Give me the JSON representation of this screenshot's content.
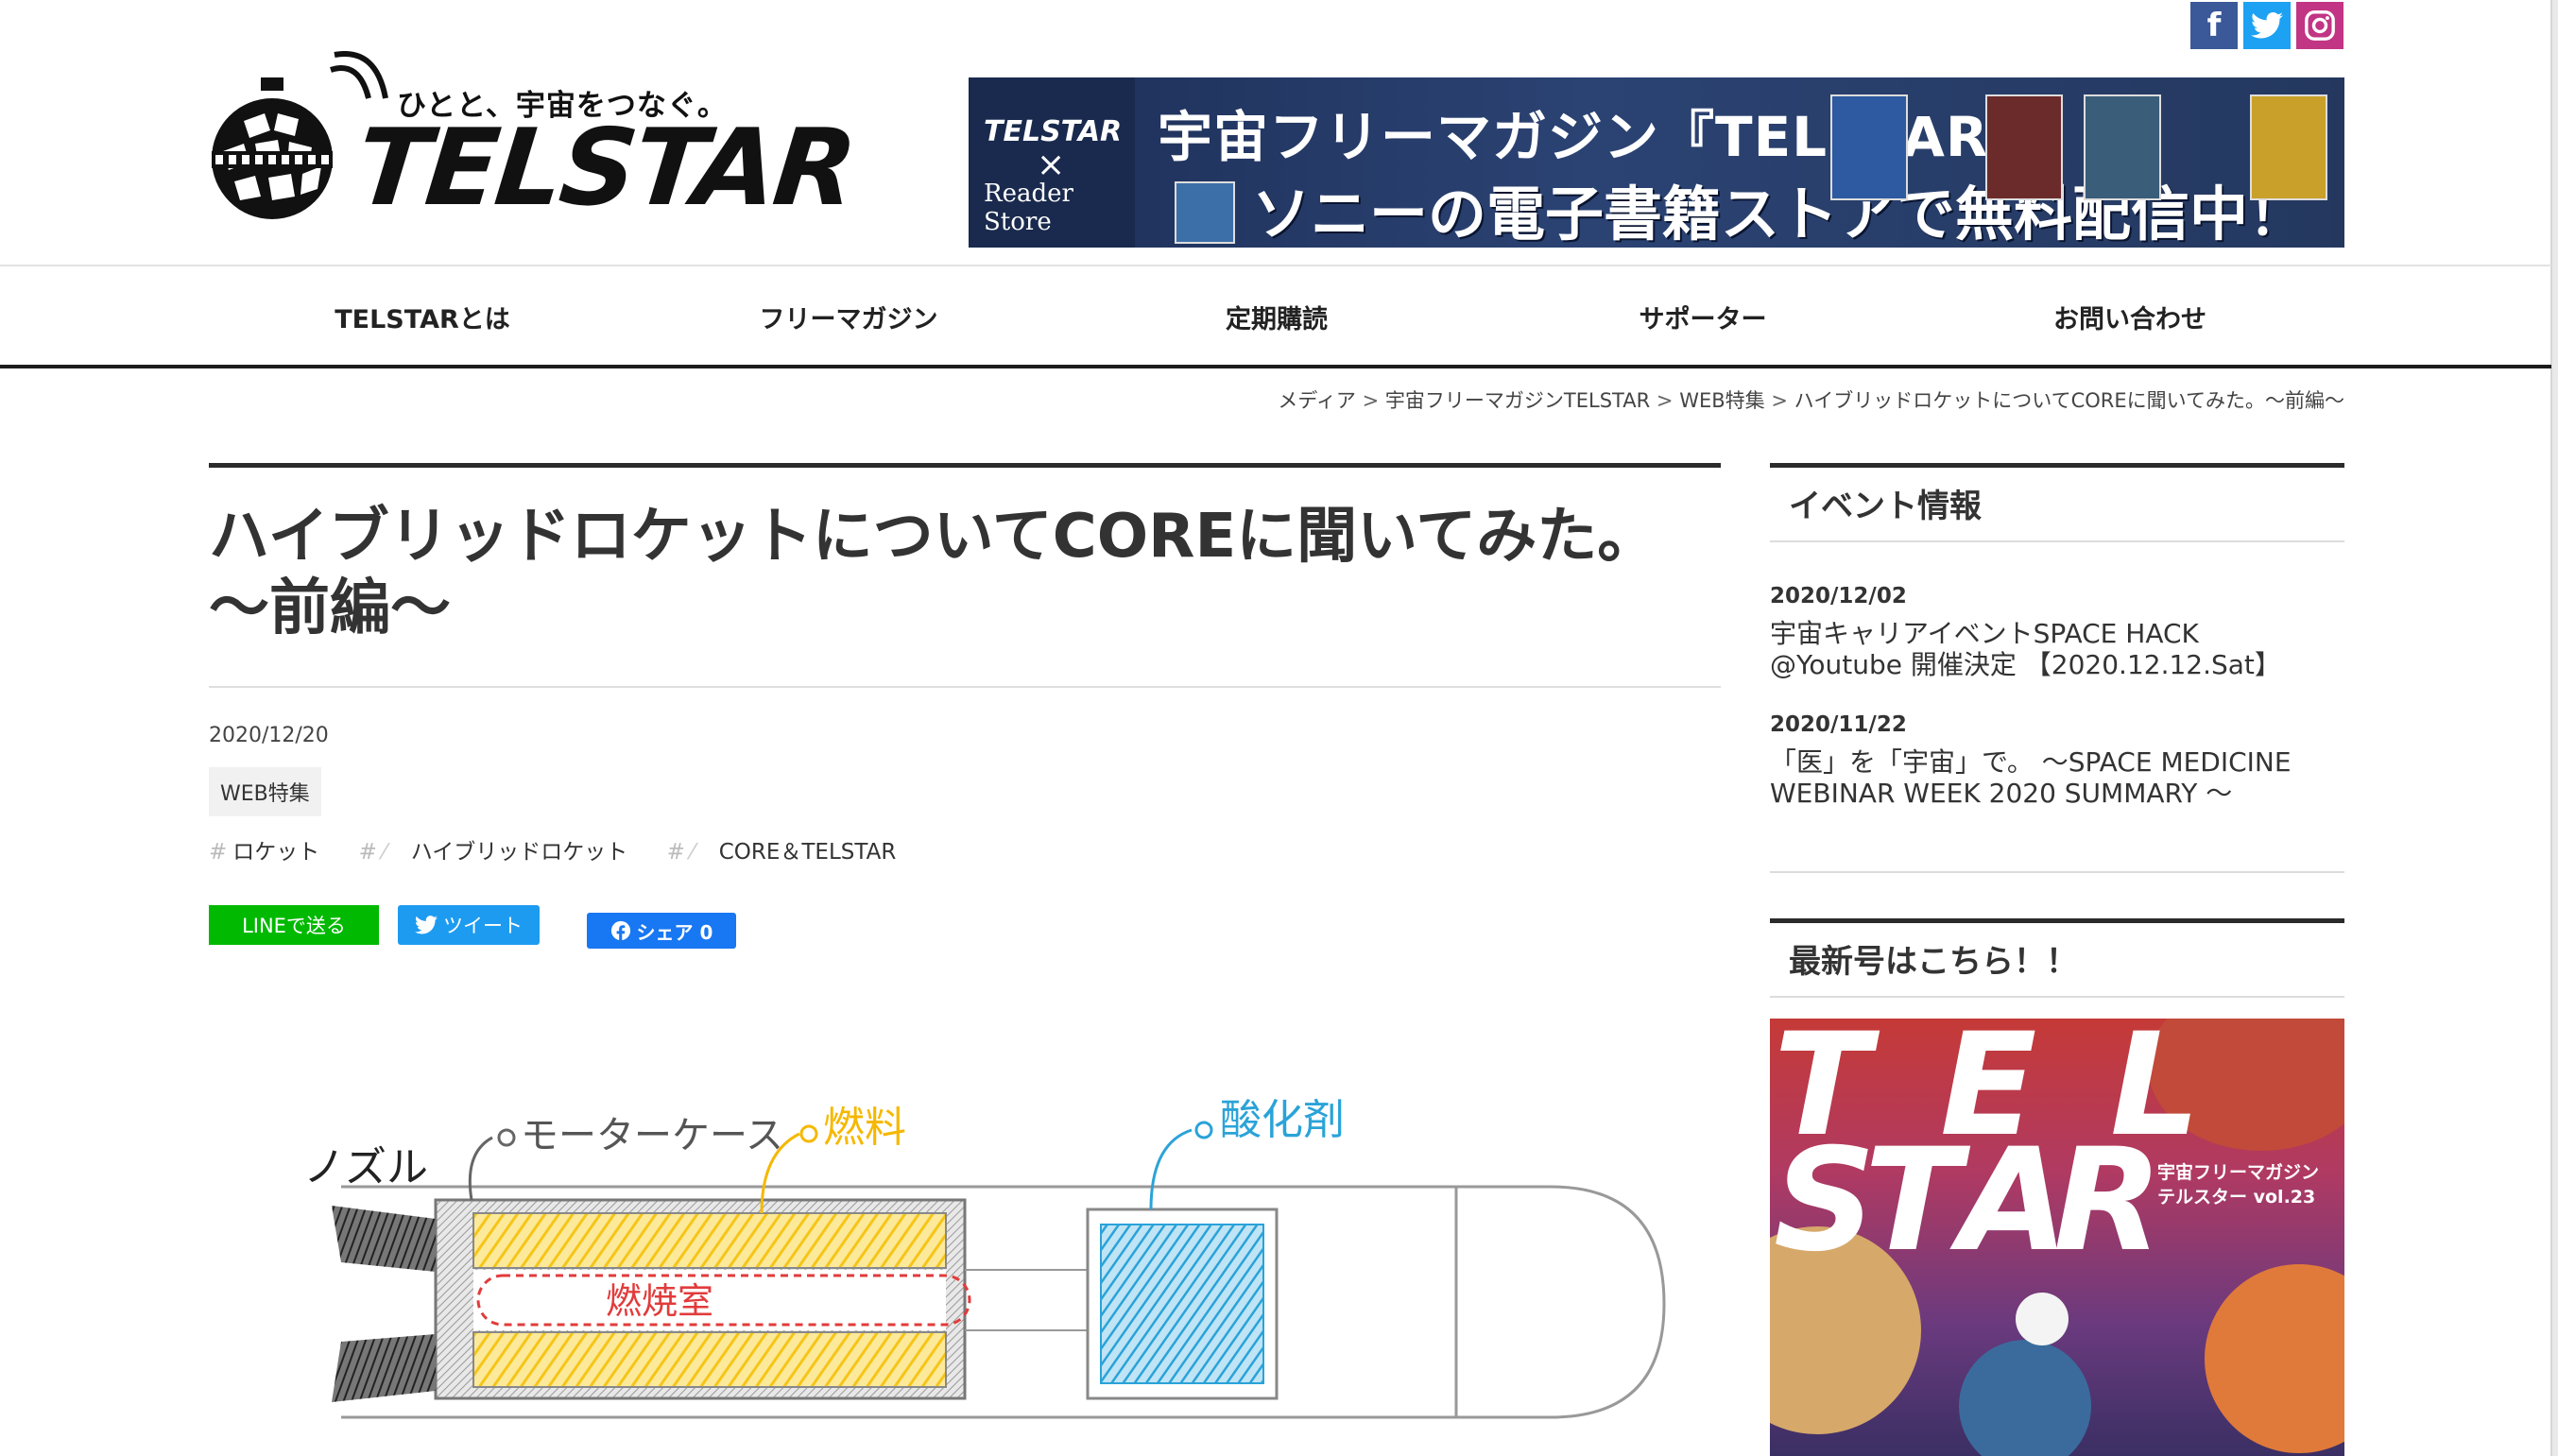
{
  "header": {
    "tagline": "ひとと、宇宙をつなぐ。",
    "logo_text": "TELSTAR",
    "social": [
      {
        "name": "facebook",
        "glyph": "f"
      },
      {
        "name": "twitter",
        "glyph": "t"
      },
      {
        "name": "instagram",
        "glyph": "◎"
      }
    ],
    "banner": {
      "brand": "TELSTAR",
      "cross": "×",
      "partner": "Reader Store",
      "line1": "宇宙フリーマガジン『TELSTAR』",
      "line2": "ソニーの電子書籍ストアで無料配信中！"
    }
  },
  "nav": {
    "items": [
      "TELSTARとは",
      "フリーマガジン",
      "定期購読",
      "サポーター",
      "お問い合わせ"
    ]
  },
  "breadcrumb": {
    "items": [
      "メディア",
      "宇宙フリーマガジンTELSTAR",
      "WEB特集",
      "ハイブリッドロケットについてCOREに聞いてみた。～前編～"
    ],
    "separator": ">"
  },
  "article": {
    "title": "ハイブリッドロケットについてCOREに聞いてみた。～前編～",
    "date": "2020/12/20",
    "category": "WEB特集",
    "tags": [
      "ロケット",
      "ハイブリッドロケット",
      "CORE＆TELSTAR"
    ],
    "tag_hash": "#",
    "share": {
      "line": "LINEで送る",
      "tweet": "ツイート",
      "facebook": "シェア 0"
    },
    "illustration_labels": {
      "nozzle": "ノズル",
      "motor_case": "モーターケース",
      "fuel": "燃料",
      "oxidizer": "酸化剤",
      "combustion_chamber": "燃焼室"
    }
  },
  "sidebar": {
    "events_heading": "イベント情報",
    "events": [
      {
        "date": "2020/12/02",
        "title": "宇宙キャリアイベントSPACE HACK @Youtube 開催決定 【2020.12.12.Sat】"
      },
      {
        "date": "2020/11/22",
        "title": "「医」を「宇宙」で。 ～SPACE MEDICINE WEBINAR WEEK 2020 SUMMARY ～"
      }
    ],
    "latest_heading": "最新号はこちら！！",
    "cover": {
      "letters": [
        "T",
        "E",
        "L",
        "S",
        "T",
        "A",
        "R"
      ],
      "caption_line1": "宇宙フリーマガジン",
      "caption_line2": "テルスター vol.23"
    }
  },
  "colors": {
    "line_green": "#00b900",
    "twitter_blue": "#1d9bf0",
    "facebook_blue": "#1877f2",
    "fuel_yellow": "#f5c518",
    "oxidizer_blue": "#2aa3d8",
    "chamber_red": "#e23b3b"
  }
}
